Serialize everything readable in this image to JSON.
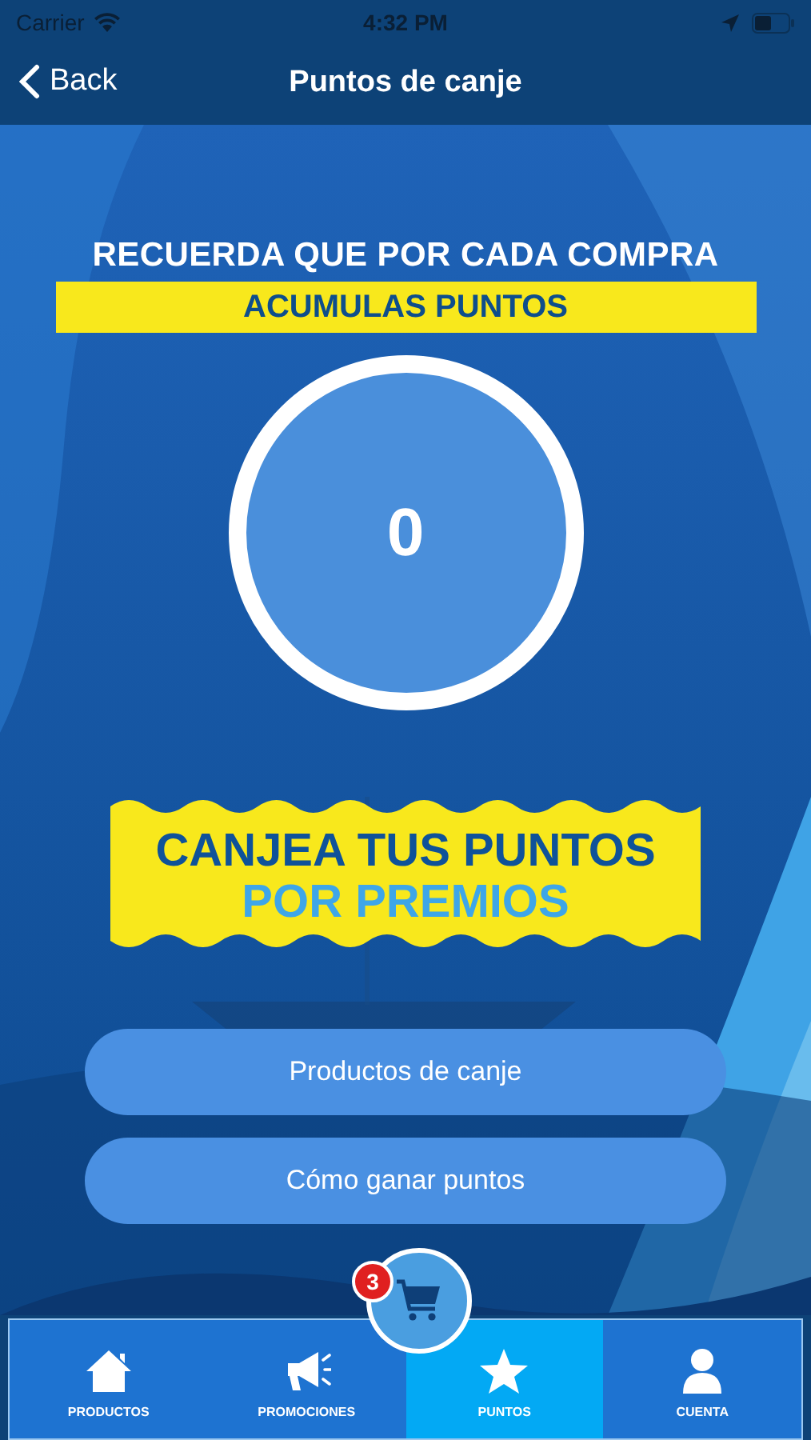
{
  "status_bar": {
    "carrier": "Carrier",
    "time": "4:32 PM"
  },
  "nav": {
    "back": "Back",
    "title": "Puntos de canje"
  },
  "headline": "RECUERDA QUE POR CADA COMPRA",
  "highlight": "ACUMULAS PUNTOS",
  "points": "0",
  "banner": {
    "line_1": "CANJEA TUS PUNTOS",
    "line_2": "POR PREMIOS"
  },
  "buttons": [
    "Productos de canje",
    "Cómo ganar puntos"
  ],
  "cart": {
    "badge": "3"
  },
  "tabs": [
    {
      "label": "PRODUCTOS",
      "selected": false
    },
    {
      "label": "PROMOCIONES",
      "selected": false
    },
    {
      "label": "PUNTOS",
      "selected": true
    },
    {
      "label": "CUENTA",
      "selected": false
    }
  ]
}
